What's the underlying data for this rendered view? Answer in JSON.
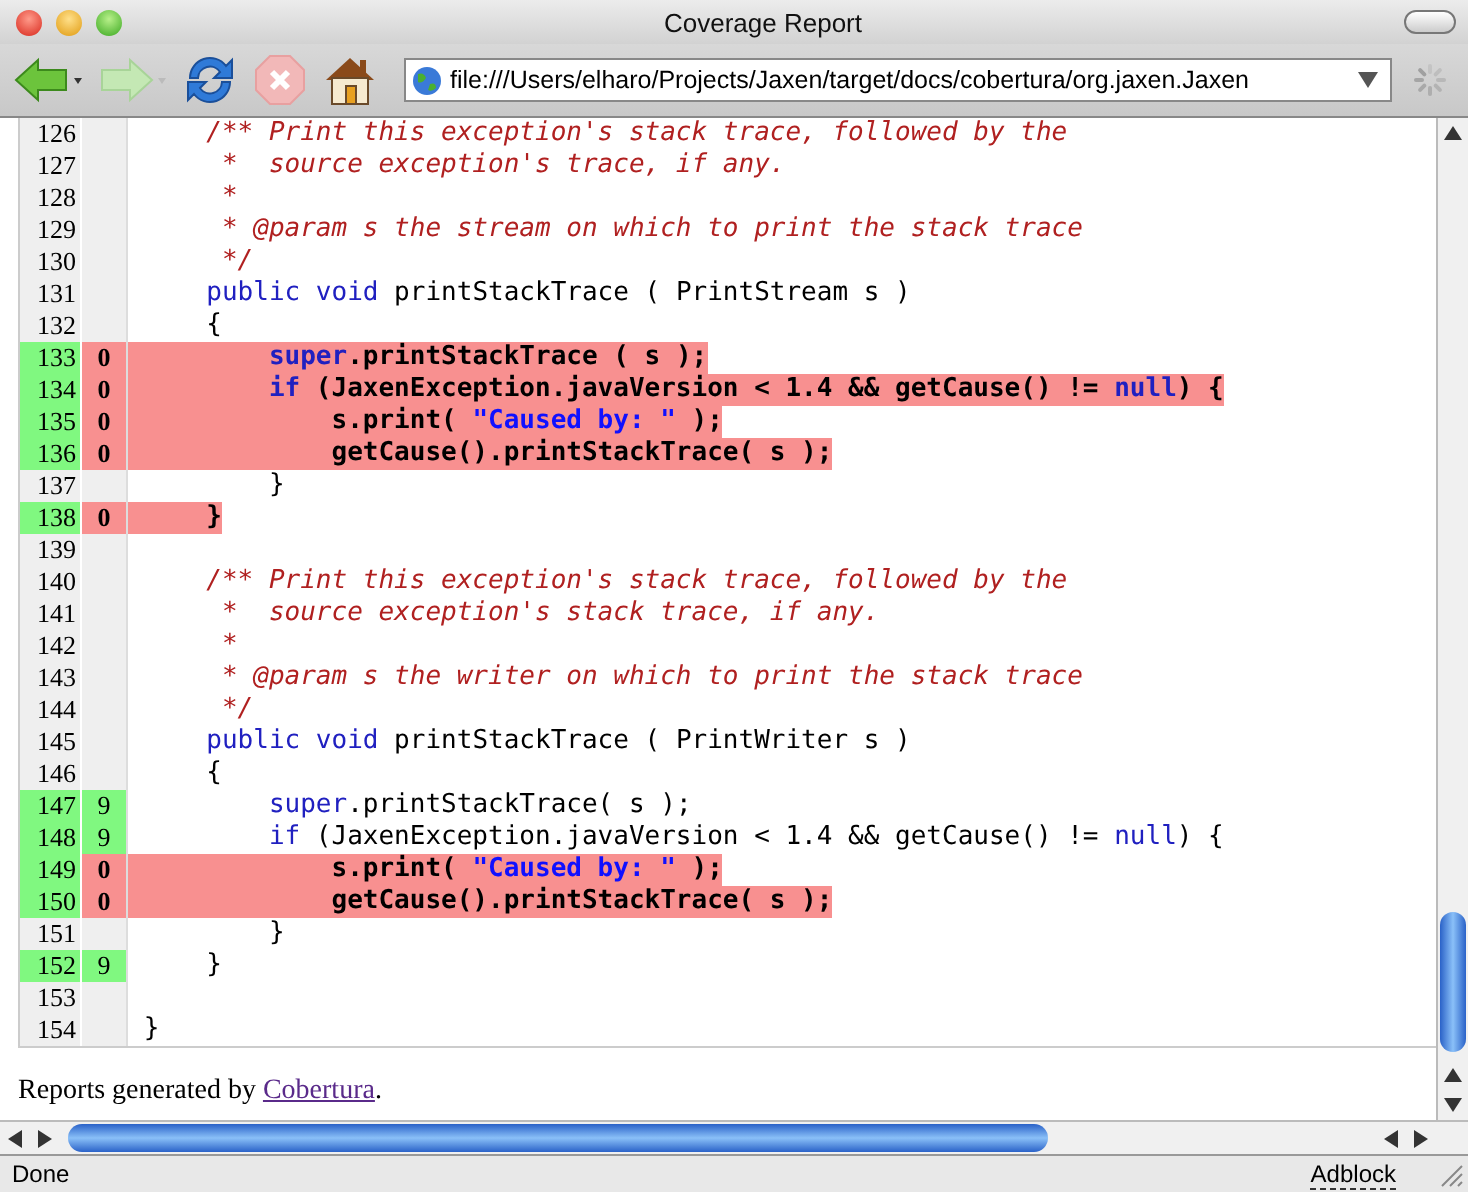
{
  "window": {
    "title": "Coverage Report"
  },
  "toolbar": {
    "buttons": [
      {
        "kind": "back",
        "disabled": false
      },
      {
        "kind": "forward",
        "disabled": true
      },
      {
        "kind": "reload",
        "disabled": false
      },
      {
        "kind": "stop",
        "disabled": true
      },
      {
        "kind": "home",
        "disabled": false
      }
    ],
    "address": {
      "value": "file:///Users/elharo/Projects/Jaxen/target/docs/cobertura/org.jaxen.Jaxen"
    }
  },
  "source": {
    "lines": [
      {
        "number": "126",
        "executable": false,
        "missed": false,
        "tokens": [
          {
            "kind": "comment",
            "text": "     /** Print this exception's stack trace, followed by the"
          }
        ]
      },
      {
        "number": "127",
        "executable": false,
        "missed": false,
        "tokens": [
          {
            "kind": "comment",
            "text": "      *  source exception's trace, if any."
          }
        ]
      },
      {
        "number": "128",
        "executable": false,
        "missed": false,
        "tokens": [
          {
            "kind": "comment",
            "text": "      *"
          }
        ]
      },
      {
        "number": "129",
        "executable": false,
        "missed": false,
        "tokens": [
          {
            "kind": "comment",
            "text": "      * @param s the stream on which to print the stack trace"
          }
        ]
      },
      {
        "number": "130",
        "executable": false,
        "missed": false,
        "tokens": [
          {
            "kind": "comment",
            "text": "      */"
          }
        ]
      },
      {
        "number": "131",
        "executable": false,
        "missed": false,
        "tokens": [
          {
            "kind": "keyword",
            "text": "     public void"
          },
          {
            "kind": "plain",
            "text": " printStackTrace ( PrintStream s )"
          }
        ]
      },
      {
        "number": "132",
        "executable": false,
        "missed": false,
        "tokens": [
          {
            "kind": "plain",
            "text": "     {"
          }
        ]
      },
      {
        "number": "133",
        "hits": "0",
        "executable": true,
        "missed": true,
        "tokens": [
          {
            "kind": "keyword",
            "text": "         super"
          },
          {
            "kind": "plain",
            "text": ".printStackTrace ( s );"
          }
        ]
      },
      {
        "number": "134",
        "hits": "0",
        "executable": true,
        "missed": true,
        "tokens": [
          {
            "kind": "keyword",
            "text": "         if"
          },
          {
            "kind": "plain",
            "text": " (JaxenException.javaVersion < 1.4 && getCause() != "
          },
          {
            "kind": "keyword",
            "text": "null"
          },
          {
            "kind": "plain",
            "text": ") {"
          }
        ]
      },
      {
        "number": "135",
        "hits": "0",
        "executable": true,
        "missed": true,
        "tokens": [
          {
            "kind": "plain",
            "text": "             s.print( "
          },
          {
            "kind": "string",
            "text": "\"Caused by: \""
          },
          {
            "kind": "plain",
            "text": " );"
          }
        ]
      },
      {
        "number": "136",
        "hits": "0",
        "executable": true,
        "missed": true,
        "tokens": [
          {
            "kind": "plain",
            "text": "             getCause().printStackTrace( s );"
          }
        ]
      },
      {
        "number": "137",
        "executable": false,
        "missed": false,
        "tokens": [
          {
            "kind": "plain",
            "text": "         }"
          }
        ]
      },
      {
        "number": "138",
        "hits": "0",
        "executable": true,
        "missed": true,
        "tokens": [
          {
            "kind": "plain",
            "text": "     }"
          }
        ]
      },
      {
        "number": "139",
        "executable": false,
        "missed": false
      },
      {
        "number": "140",
        "executable": false,
        "missed": false,
        "tokens": [
          {
            "kind": "comment",
            "text": "     /** Print this exception's stack trace, followed by the"
          }
        ]
      },
      {
        "number": "141",
        "executable": false,
        "missed": false,
        "tokens": [
          {
            "kind": "comment",
            "text": "      *  source exception's stack trace, if any."
          }
        ]
      },
      {
        "number": "142",
        "executable": false,
        "missed": false,
        "tokens": [
          {
            "kind": "comment",
            "text": "      *"
          }
        ]
      },
      {
        "number": "143",
        "executable": false,
        "missed": false,
        "tokens": [
          {
            "kind": "comment",
            "text": "      * @param s the writer on which to print the stack trace"
          }
        ]
      },
      {
        "number": "144",
        "executable": false,
        "missed": false,
        "tokens": [
          {
            "kind": "comment",
            "text": "      */"
          }
        ]
      },
      {
        "number": "145",
        "executable": false,
        "missed": false,
        "tokens": [
          {
            "kind": "keyword",
            "text": "     public void"
          },
          {
            "kind": "plain",
            "text": " printStackTrace ( PrintWriter s )"
          }
        ]
      },
      {
        "number": "146",
        "executable": false,
        "missed": false,
        "tokens": [
          {
            "kind": "plain",
            "text": "     {"
          }
        ]
      },
      {
        "number": "147",
        "hits": "9",
        "executable": true,
        "missed": false,
        "tokens": [
          {
            "kind": "keyword",
            "text": "         super"
          },
          {
            "kind": "plain",
            "text": ".printStackTrace( s );"
          }
        ]
      },
      {
        "number": "148",
        "hits": "9",
        "executable": true,
        "missed": false,
        "tokens": [
          {
            "kind": "keyword",
            "text": "         if"
          },
          {
            "kind": "plain",
            "text": " (JaxenException.javaVersion < 1.4 && getCause() != "
          },
          {
            "kind": "keyword",
            "text": "null"
          },
          {
            "kind": "plain",
            "text": ") {"
          }
        ]
      },
      {
        "number": "149",
        "hits": "0",
        "executable": true,
        "missed": true,
        "tokens": [
          {
            "kind": "plain",
            "text": "             s.print( "
          },
          {
            "kind": "string",
            "text": "\"Caused by: \""
          },
          {
            "kind": "plain",
            "text": " );"
          }
        ]
      },
      {
        "number": "150",
        "hits": "0",
        "executable": true,
        "missed": true,
        "tokens": [
          {
            "kind": "plain",
            "text": "             getCause().printStackTrace( s );"
          }
        ]
      },
      {
        "number": "151",
        "executable": false,
        "missed": false,
        "tokens": [
          {
            "kind": "plain",
            "text": "         }"
          }
        ]
      },
      {
        "number": "152",
        "hits": "9",
        "executable": true,
        "missed": false,
        "tokens": [
          {
            "kind": "plain",
            "text": "     }"
          }
        ]
      },
      {
        "number": "153",
        "executable": false,
        "missed": false
      },
      {
        "number": "154",
        "executable": false,
        "missed": false,
        "tokens": [
          {
            "kind": "plain",
            "text": " }"
          }
        ]
      }
    ]
  },
  "footer": {
    "text": "Reports generated by ",
    "link": "Cobertura",
    "after": "."
  },
  "status_bar": {
    "status": "Done",
    "extension": "Adblock"
  }
}
